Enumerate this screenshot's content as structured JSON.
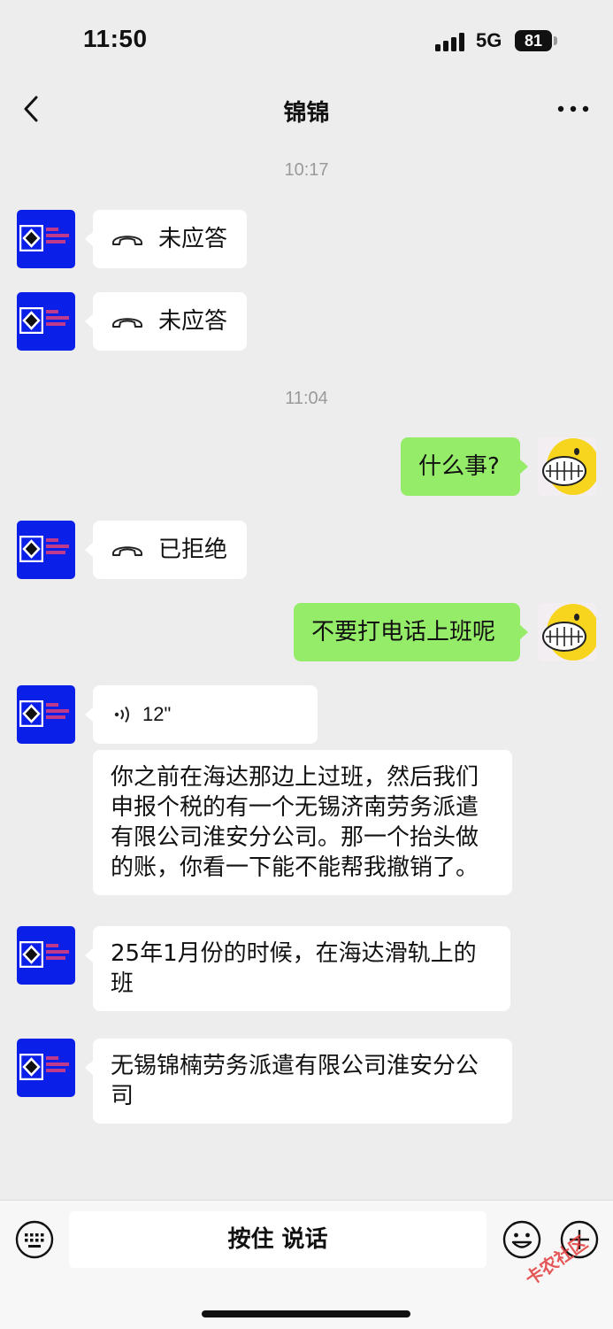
{
  "status_bar": {
    "time": "11:50",
    "network": "5G",
    "battery": "81"
  },
  "header": {
    "title": "锦锦"
  },
  "messages": {
    "ts1": "10:17",
    "m1": "未应答",
    "m2": "未应答",
    "ts2": "11:04",
    "m3": "什么事?",
    "m4": "已拒绝",
    "m5": "不要打电话上班呢",
    "m6": "12\"",
    "m7": "你之前在海达那边上过班，然后我们申报个税的有一个无锡济南劳务派遣有限公司淮安分公司。那一个抬头做的账，你看一下能不能帮我撤销了。",
    "m8": "25年1月份的时候，在海达滑轨上的班",
    "m9": "无锡锦楠劳务派遣有限公司淮安分公司"
  },
  "input_bar": {
    "talk_label": "按住 说话"
  },
  "watermark": "卡农社区",
  "colors": {
    "avatar_blue": "#0a1fe8",
    "outgoing_bubble": "#95ec69",
    "background": "#ededed"
  }
}
